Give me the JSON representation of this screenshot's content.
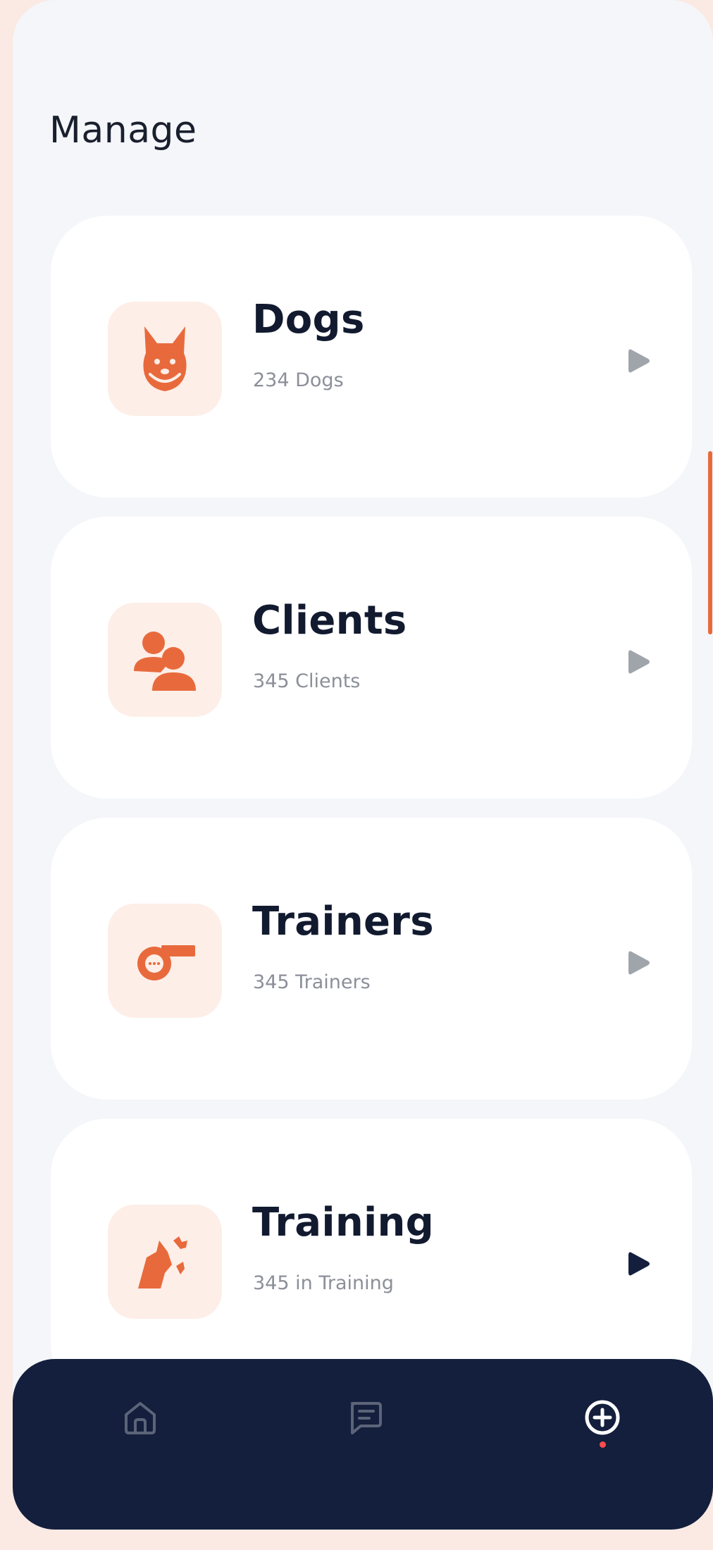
{
  "page": {
    "title": "Manage"
  },
  "colors": {
    "background": "#f4f6f9",
    "outer_background": "#fbe9e4",
    "accent": "#e86a3c",
    "icon_tile": "#fdeee8",
    "nav_background": "#131f3c",
    "heading": "#121a2f",
    "subtext": "#8c8f99",
    "chevron_inactive": "#a0a4ab",
    "chevron_active": "#131f3c",
    "nav_dot": "#ff4b4b"
  },
  "cards": [
    {
      "title": "Dogs",
      "subtitle": "234 Dogs",
      "icon": "dog-icon",
      "chevron": "inactive"
    },
    {
      "title": "Clients",
      "subtitle": "345 Clients",
      "icon": "clients-icon",
      "chevron": "inactive"
    },
    {
      "title": "Trainers",
      "subtitle": "345 Trainers",
      "icon": "whistle-icon",
      "chevron": "inactive"
    },
    {
      "title": "Training",
      "subtitle": "345 in Training",
      "icon": "dog-training-icon",
      "chevron": "active"
    }
  ],
  "nav": {
    "items": [
      {
        "icon": "home-icon",
        "active": false
      },
      {
        "icon": "chat-icon",
        "active": false
      },
      {
        "icon": "add-circle-icon",
        "active": true
      }
    ]
  }
}
